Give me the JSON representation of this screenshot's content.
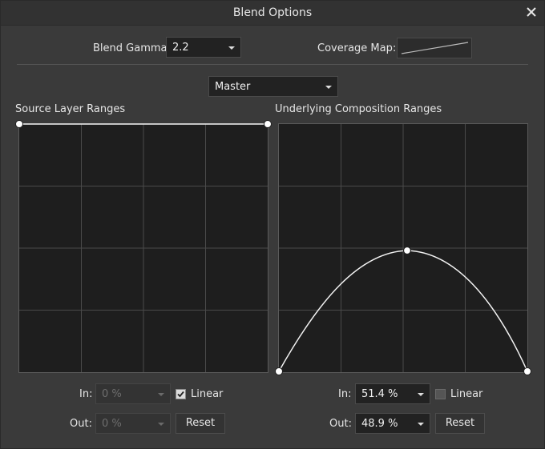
{
  "window": {
    "title": "Blend Options",
    "close_icon": "close-icon"
  },
  "blend_gamma": {
    "label": "Blend Gamma:",
    "value": "2.2"
  },
  "coverage_map": {
    "label": "Coverage Map:"
  },
  "channel": {
    "value": "Master"
  },
  "source": {
    "heading": "Source Layer Ranges",
    "in_label": "In:",
    "in_value": "0 %",
    "out_label": "Out:",
    "out_value": "0 %",
    "linear_label": "Linear",
    "linear_checked": true,
    "reset_label": "Reset"
  },
  "underlying": {
    "heading": "Underlying Composition Ranges",
    "in_label": "In:",
    "in_value": "51.4 %",
    "out_label": "Out:",
    "out_value": "48.9 %",
    "linear_label": "Linear",
    "linear_checked": false,
    "reset_label": "Reset"
  }
}
